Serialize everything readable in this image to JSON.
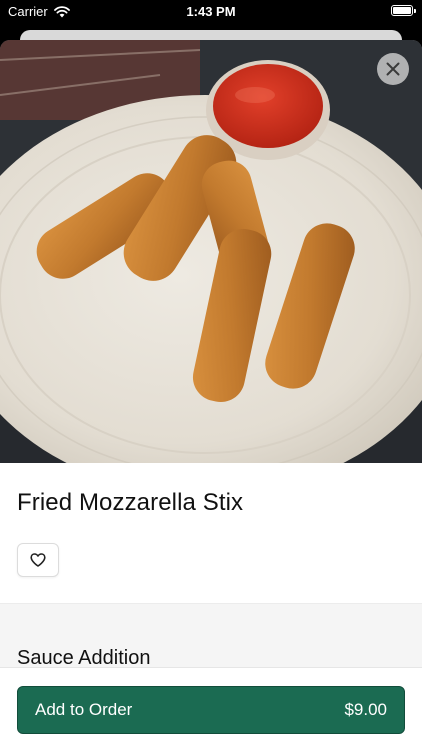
{
  "status_bar": {
    "carrier": "Carrier",
    "time": "1:43 PM"
  },
  "item": {
    "name": "Fried Mozzarella Stix",
    "image_alt": "Fried mozzarella sticks on a paper plate with marinara sauce"
  },
  "section": {
    "title": "Sauce Addition"
  },
  "order": {
    "add_label": "Add to Order",
    "price": "$9.00"
  },
  "colors": {
    "primary": "#1b6b52"
  },
  "icons": {
    "close": "close-icon",
    "favorite": "heart-icon",
    "wifi": "wifi-icon",
    "battery": "battery-icon"
  }
}
